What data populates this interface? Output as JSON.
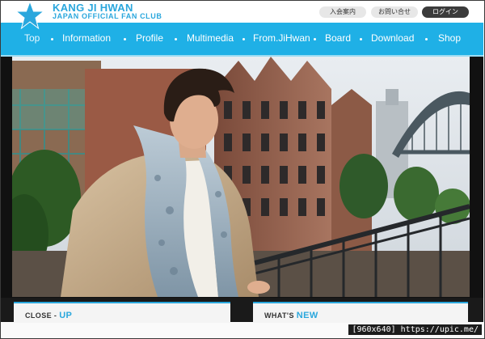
{
  "site": {
    "title": "KANG JI HWAN",
    "subtitle": "JAPAN OFFICIAL FAN CLUB"
  },
  "header_buttons": [
    {
      "label": "入会案内",
      "style": "light"
    },
    {
      "label": "お問い合せ",
      "style": "light"
    },
    {
      "label": "ログイン",
      "style": "dark"
    }
  ],
  "nav": {
    "items": [
      "Top",
      "Information",
      "Profile",
      "Multimedia",
      "From.JiHwan",
      "Board",
      "Download",
      "Shop"
    ],
    "active": "Top"
  },
  "sections": {
    "closeup": {
      "prefix": "CLOSE - ",
      "accent": "UP"
    },
    "whatsnew": {
      "prefix": "WHAT'S ",
      "accent": "NEW"
    }
  },
  "watermark": "[960x640] https://upic.me/",
  "colors": {
    "accent": "#2aa7dd",
    "nav": "#1fb0e6",
    "login_button": "#3b3b3b"
  },
  "icons": [
    "star-logo-icon"
  ]
}
